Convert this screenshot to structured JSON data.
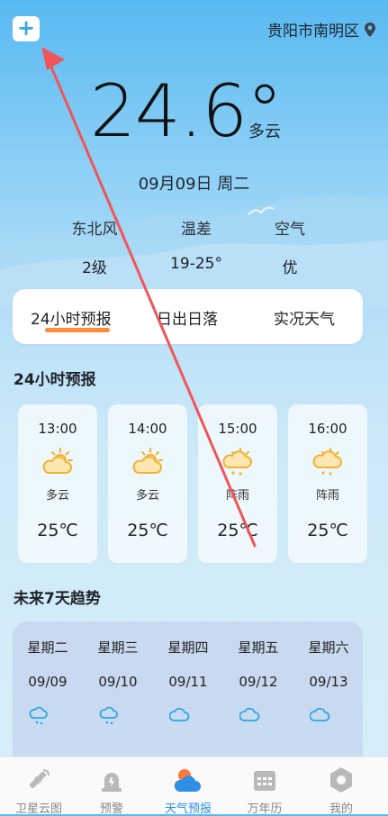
{
  "header": {
    "add_label": "+",
    "location": "贵阳市南明区"
  },
  "current": {
    "temperature": "24.6°",
    "condition": "多云",
    "date": "09月09日  周二"
  },
  "stats": [
    {
      "label": "东北风",
      "value": "2级"
    },
    {
      "label": "温差",
      "value": "19-25°"
    },
    {
      "label": "空气",
      "value": "优"
    }
  ],
  "tabs": [
    "24小时预报",
    "日出日落",
    "实况天气"
  ],
  "hourly_title": "24小时预报",
  "hourly": [
    {
      "time": "13:00",
      "cond": "多云",
      "temp": "25℃",
      "icon": "partly-cloudy-icon"
    },
    {
      "time": "14:00",
      "cond": "多云",
      "temp": "25℃",
      "icon": "partly-cloudy-icon"
    },
    {
      "time": "15:00",
      "cond": "阵雨",
      "temp": "25℃",
      "icon": "shower-icon"
    },
    {
      "time": "16:00",
      "cond": "阵雨",
      "temp": "25℃",
      "icon": "shower-icon"
    }
  ],
  "week_title": "未来7天趋势",
  "week": [
    {
      "day": "星期二",
      "date": "09/09",
      "icon": "shower-icon"
    },
    {
      "day": "星期三",
      "date": "09/10",
      "icon": "shower-icon"
    },
    {
      "day": "星期四",
      "date": "09/11",
      "icon": "cloud-icon"
    },
    {
      "day": "星期五",
      "date": "09/12",
      "icon": "cloud-icon"
    },
    {
      "day": "星期六",
      "date": "09/13",
      "icon": "cloud-icon"
    }
  ],
  "nav": [
    {
      "label": "卫星云图",
      "icon": "satellite-icon"
    },
    {
      "label": "预警",
      "icon": "alarm-icon"
    },
    {
      "label": "天气预报",
      "icon": "weather-cloud-icon",
      "active": true
    },
    {
      "label": "万年历",
      "icon": "calendar-icon"
    },
    {
      "label": "我的",
      "icon": "profile-icon"
    }
  ],
  "colors": {
    "accent": "#2e8fe6",
    "tab_indicator": "#ff8a3d",
    "annotation_arrow": "#f0555a"
  }
}
